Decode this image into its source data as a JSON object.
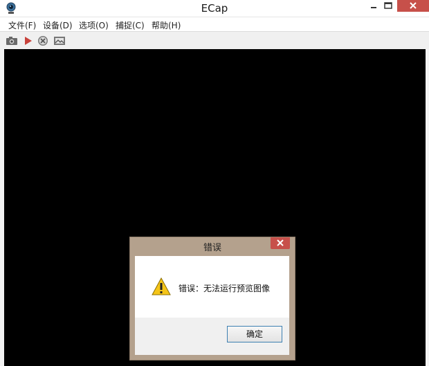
{
  "window": {
    "title": "ECap",
    "controls": {
      "minimize": "minimize",
      "maximize": "maximize",
      "close": "close"
    }
  },
  "menubar": {
    "items": [
      {
        "label": "文件(F)"
      },
      {
        "label": "设备(D)"
      },
      {
        "label": "选项(O)"
      },
      {
        "label": "捕捉(C)"
      },
      {
        "label": "帮助(H)"
      }
    ]
  },
  "toolbar": {
    "buttons": [
      {
        "icon": "camera-icon"
      },
      {
        "icon": "play-icon"
      },
      {
        "icon": "stop-icon"
      },
      {
        "icon": "image-icon"
      }
    ]
  },
  "preview": {
    "background": "#000000"
  },
  "dialog": {
    "title": "错误",
    "message": "错误：无法运行预览图像",
    "ok_label": "确定",
    "icon": "warning-icon"
  },
  "colors": {
    "dialog_frame": "#b4a18d",
    "close_button": "#c7504a",
    "ok_border": "#3c7fb1"
  }
}
